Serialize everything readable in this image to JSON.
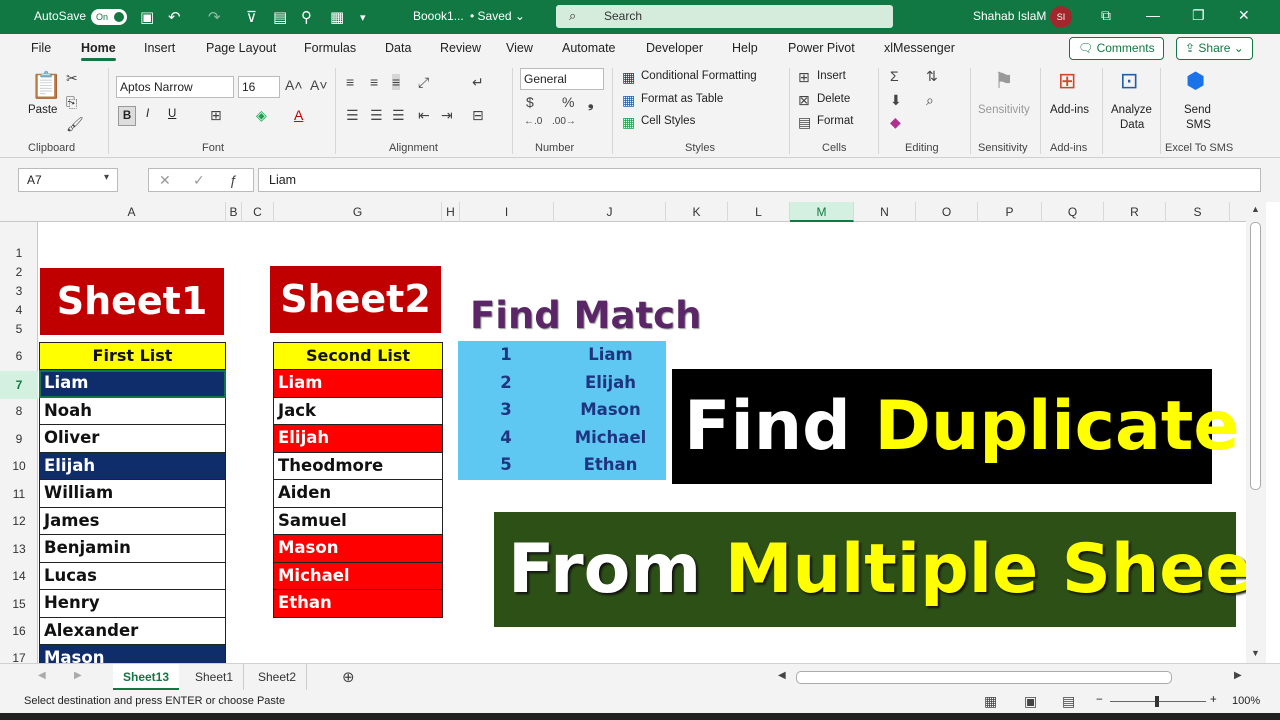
{
  "titlebar": {
    "autosave_label": "AutoSave",
    "autosave_state": "On",
    "doc_title": "Boook1...",
    "saved_state": "Saved",
    "search_placeholder": "Search",
    "user_name": "Shahab IslaM",
    "user_initials": "SI"
  },
  "menu": {
    "items": [
      "File",
      "Home",
      "Insert",
      "Page Layout",
      "Formulas",
      "Data",
      "Review",
      "View",
      "Automate",
      "Developer",
      "Help",
      "Power Pivot",
      "xlMessenger"
    ],
    "active": "Home",
    "comments_label": "Comments",
    "share_label": "Share"
  },
  "ribbon": {
    "clipboard": {
      "paste_label": "Paste",
      "group_label": "Clipboard"
    },
    "font": {
      "font_name": "Aptos Narrow",
      "font_size": "16",
      "bold": "B",
      "italic": "I",
      "underline": "U",
      "group_label": "Font"
    },
    "alignment": {
      "group_label": "Alignment"
    },
    "number": {
      "format": "General",
      "group_label": "Number"
    },
    "styles": {
      "conditional": "Conditional Formatting",
      "format_table": "Format as Table",
      "cell_styles": "Cell Styles",
      "group_label": "Styles"
    },
    "cells": {
      "insert": "Insert",
      "delete": "Delete",
      "format": "Format",
      "group_label": "Cells"
    },
    "editing": {
      "group_label": "Editing"
    },
    "sensitivity": {
      "label": "Sensitivity",
      "group_label": "Sensitivity"
    },
    "addins": {
      "label": "Add-ins",
      "group_label": "Add-ins"
    },
    "analyze": {
      "label1": "Analyze",
      "label2": "Data"
    },
    "sms": {
      "label1": "Send",
      "label2": "SMS",
      "group_label": "Excel To SMS"
    }
  },
  "formula_bar": {
    "name_box": "A7",
    "formula": "Liam"
  },
  "columns": [
    "A",
    "B",
    "C",
    "G",
    "H",
    "I",
    "J",
    "K",
    "L",
    "M",
    "N",
    "O",
    "P",
    "Q",
    "R",
    "S"
  ],
  "rows": [
    "1",
    "2",
    "3",
    "4",
    "5",
    "6",
    "7",
    "8",
    "9",
    "10",
    "11",
    "12",
    "13",
    "14",
    "15",
    "16",
    "17"
  ],
  "content": {
    "sheet1_banner": "Sheet1",
    "sheet2_banner": "Sheet2",
    "first_list_header": "First List",
    "second_list_header": "Second List",
    "first_list": [
      "Liam",
      "Noah",
      "Oliver",
      "Elijah",
      "William",
      "James",
      "Benjamin",
      "Lucas",
      "Henry",
      "Alexander",
      "Mason"
    ],
    "second_list": [
      "Liam",
      "Jack",
      "Elijah",
      "Theodmore",
      "Aiden",
      "Samuel",
      "Mason",
      "Michael",
      "Ethan"
    ],
    "find_match_title": "Find Match",
    "matches": [
      {
        "n": "1",
        "name": "Liam"
      },
      {
        "n": "2",
        "name": "Elijah"
      },
      {
        "n": "3",
        "name": "Mason"
      },
      {
        "n": "4",
        "name": "Michael"
      },
      {
        "n": "5",
        "name": "Ethan"
      }
    ],
    "title1_white": "Find ",
    "title1_yellow": "Duplicate",
    "title2_white": "From ",
    "title2_yellow": "Multiple Sheet"
  },
  "tabs": [
    "Sheet13",
    "Sheet1",
    "Sheet2"
  ],
  "status": {
    "message": "Select destination and press ENTER or choose Paste",
    "zoom": "100%"
  },
  "colors": {
    "accent": "#127843",
    "banner_red": "#c00000",
    "header_yellow": "#ffff00",
    "highlight_navy": "#0f2d6b",
    "dup_red": "#ff0000",
    "match_blue": "#5fc8f2",
    "title_purple": "#5b2668",
    "green_box": "#2d5016"
  }
}
